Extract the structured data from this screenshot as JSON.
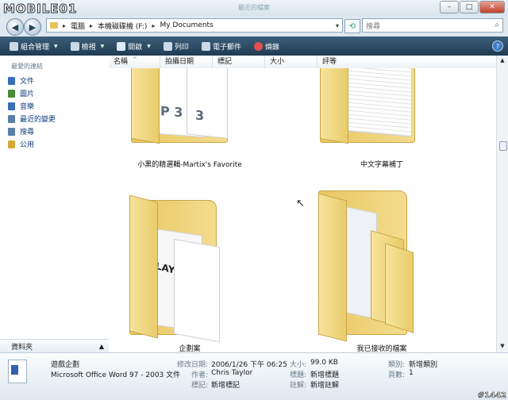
{
  "watermark": "MOBILE01",
  "corner_tag": "#1442",
  "title": "最近的檔案",
  "window_buttons": {
    "min": "–",
    "max": "□",
    "close": "✕"
  },
  "address": {
    "crumbs": [
      "電腦",
      "本機磁碟機 (F:)",
      "My Documents"
    ],
    "search_placeholder": "搜尋"
  },
  "toolbar": {
    "items": [
      {
        "label": "組合管理",
        "dropdown": true,
        "icon": "organize-icon"
      },
      {
        "label": "檢視",
        "dropdown": true,
        "icon": "views-icon"
      },
      {
        "label": "開啟",
        "dropdown": true,
        "icon": "open-icon"
      },
      {
        "label": "列印",
        "dropdown": false,
        "icon": "print-icon"
      },
      {
        "label": "電子郵件",
        "dropdown": false,
        "icon": "email-icon"
      },
      {
        "label": "燒錄",
        "dropdown": false,
        "icon": "burn-icon"
      }
    ]
  },
  "navpane": {
    "heading": "最愛的連結",
    "items": [
      {
        "label": "文件",
        "color": "#3a6fb8"
      },
      {
        "label": "圖片",
        "color": "#4a8a3a"
      },
      {
        "label": "音樂",
        "color": "#3a6fb8"
      },
      {
        "label": "最近的變更",
        "color": "#5a7fa8"
      },
      {
        "label": "搜尋",
        "color": "#5a7fa8"
      },
      {
        "label": "公用",
        "color": "#d4a93a"
      }
    ],
    "folders_label": "資料夾"
  },
  "columns": [
    "名稱",
    "拍攝日期",
    "標記",
    "大小",
    "評等"
  ],
  "folders": [
    {
      "name": "小黑的精選輯-Martix's Favorite"
    },
    {
      "name": "中文字幕補丁"
    },
    {
      "name": "企劃案"
    },
    {
      "name": "我已接收的檔案"
    }
  ],
  "details": {
    "file_name": "遊戲企劃",
    "file_type": "Microsoft Office Word 97 - 2003 文件",
    "modified_label": "修改日期:",
    "modified_value": "2006/1/26 下午 06:25",
    "author_label": "作者:",
    "author_value": "Chris Taylor",
    "tags_label": "標記:",
    "tags_value": "新增標記",
    "size_label": "大小:",
    "size_value": "99.0 KB",
    "title_label": "標題:",
    "title_value": "新增標題",
    "comments_label": "註解:",
    "comments_value": "新增註解",
    "category_label": "類別:",
    "category_value": "新增類別",
    "pages_label": "頁數:",
    "pages_value": "1"
  }
}
